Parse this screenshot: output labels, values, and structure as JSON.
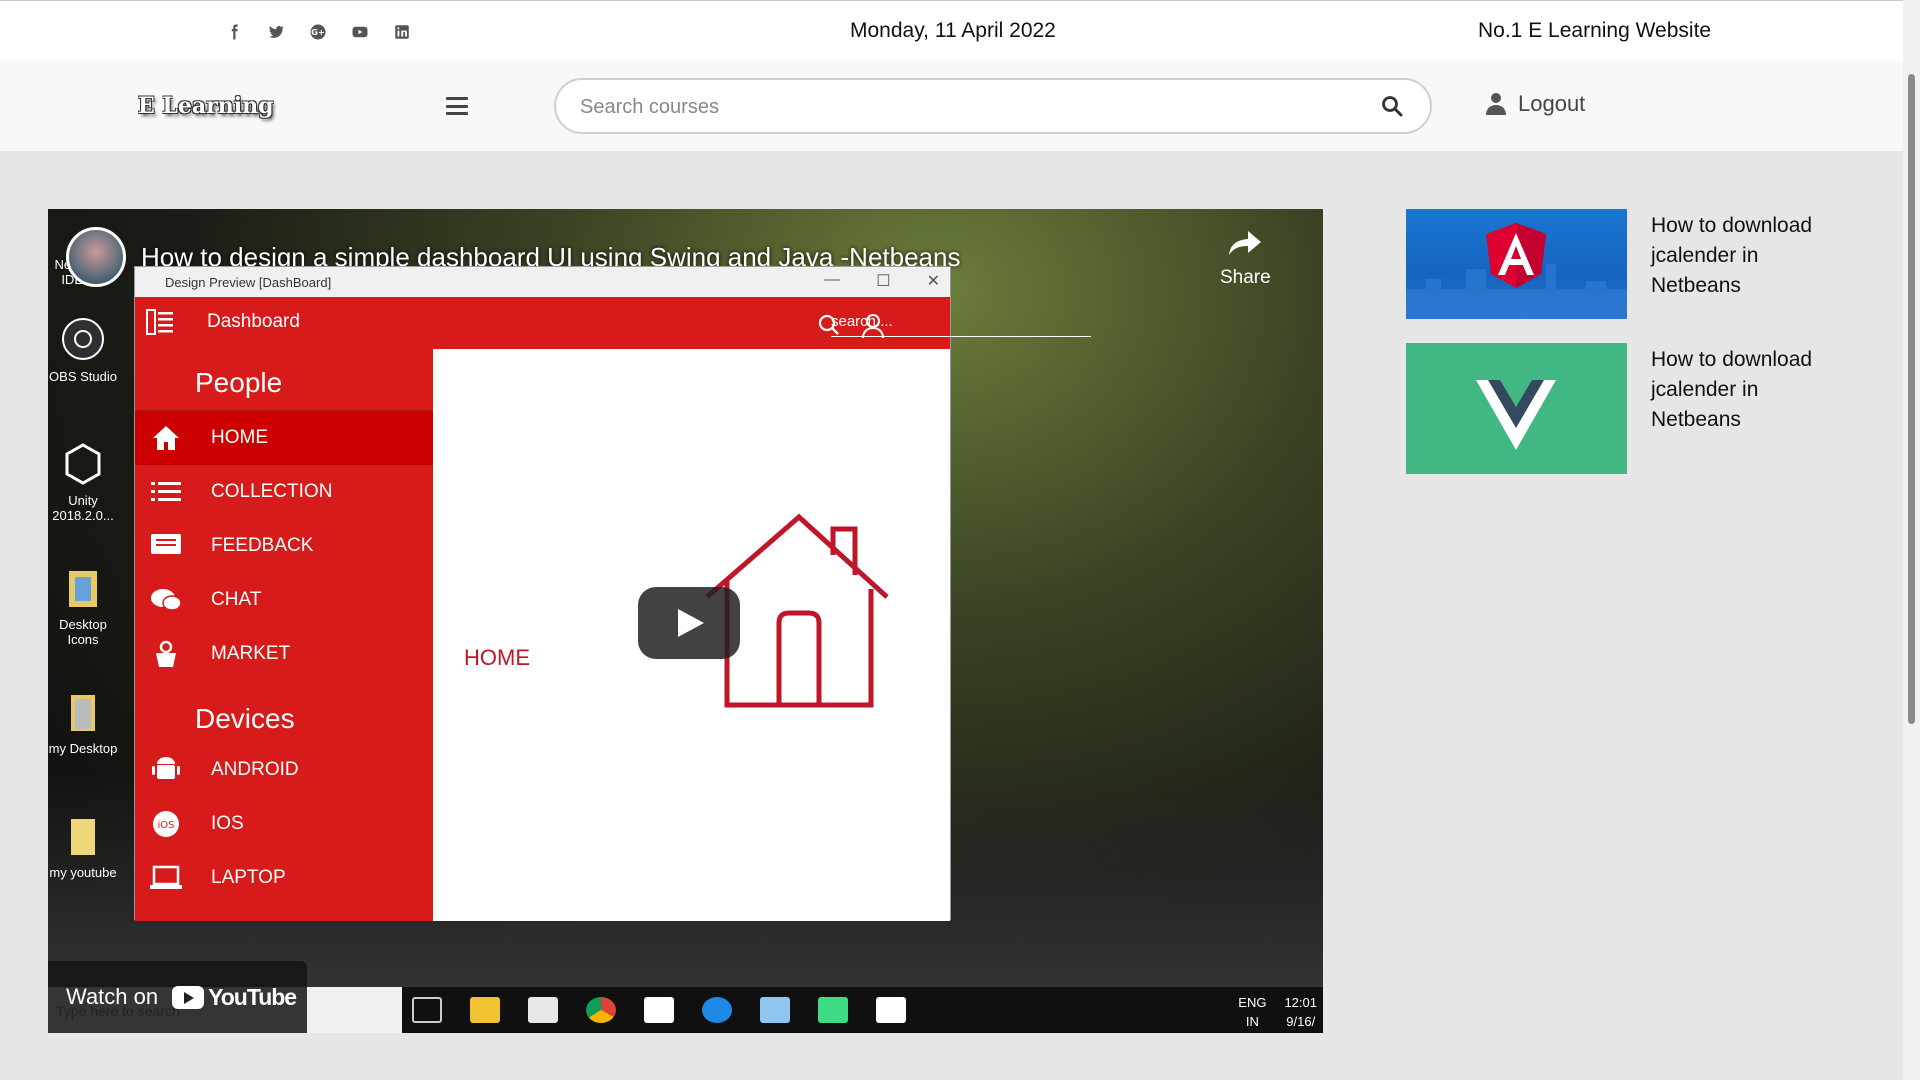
{
  "topbar": {
    "social_icons": [
      "facebook-icon",
      "twitter-icon",
      "google-plus-icon",
      "youtube-icon",
      "linkedin-icon"
    ],
    "date": "Monday, 11 April 2022",
    "tagline": "No.1 E Learning Website"
  },
  "navbar": {
    "logo": "E Learning",
    "search_placeholder": "Search courses",
    "search_value": "",
    "logout_label": "Logout"
  },
  "video": {
    "title": "How to design a simple dashboard UI using Swing and Java -Netbeans",
    "share_label": "Share",
    "watch_on": "Watch on",
    "youtube_label": "YouTube",
    "desktop_icons": [
      "NetBeans IDE 8.2",
      "OBS Studio",
      "Unity 2018.2.0...",
      "Desktop Icons",
      "my Desktop",
      "my youtube"
    ],
    "window": {
      "title": "Design Preview [DashBoard]",
      "header": "Dashboard",
      "search_placeholder": "search....",
      "sections": [
        {
          "heading": "People",
          "items": [
            "HOME",
            "COLLECTION",
            "FEEDBACK",
            "CHAT",
            "MARKET"
          ]
        },
        {
          "heading": "Devices",
          "items": [
            "ANDROID",
            "IOS",
            "LAPTOP"
          ]
        }
      ],
      "main_label": "HOME"
    },
    "taskbar": {
      "search_placeholder": "Type here to search",
      "lang": "ENG",
      "region": "IN",
      "time": "12:01",
      "date": "9/16/"
    }
  },
  "sidebar": {
    "cards": [
      {
        "title": "How to download jcalender in Netbeans",
        "thumb": "angular-logo"
      },
      {
        "title": "How to download jcalender in Netbeans",
        "thumb": "vue-logo"
      }
    ]
  },
  "colors": {
    "accent_red": "#d71a1a",
    "angular_blue": "#1976d2",
    "vue_green": "#41b883"
  }
}
